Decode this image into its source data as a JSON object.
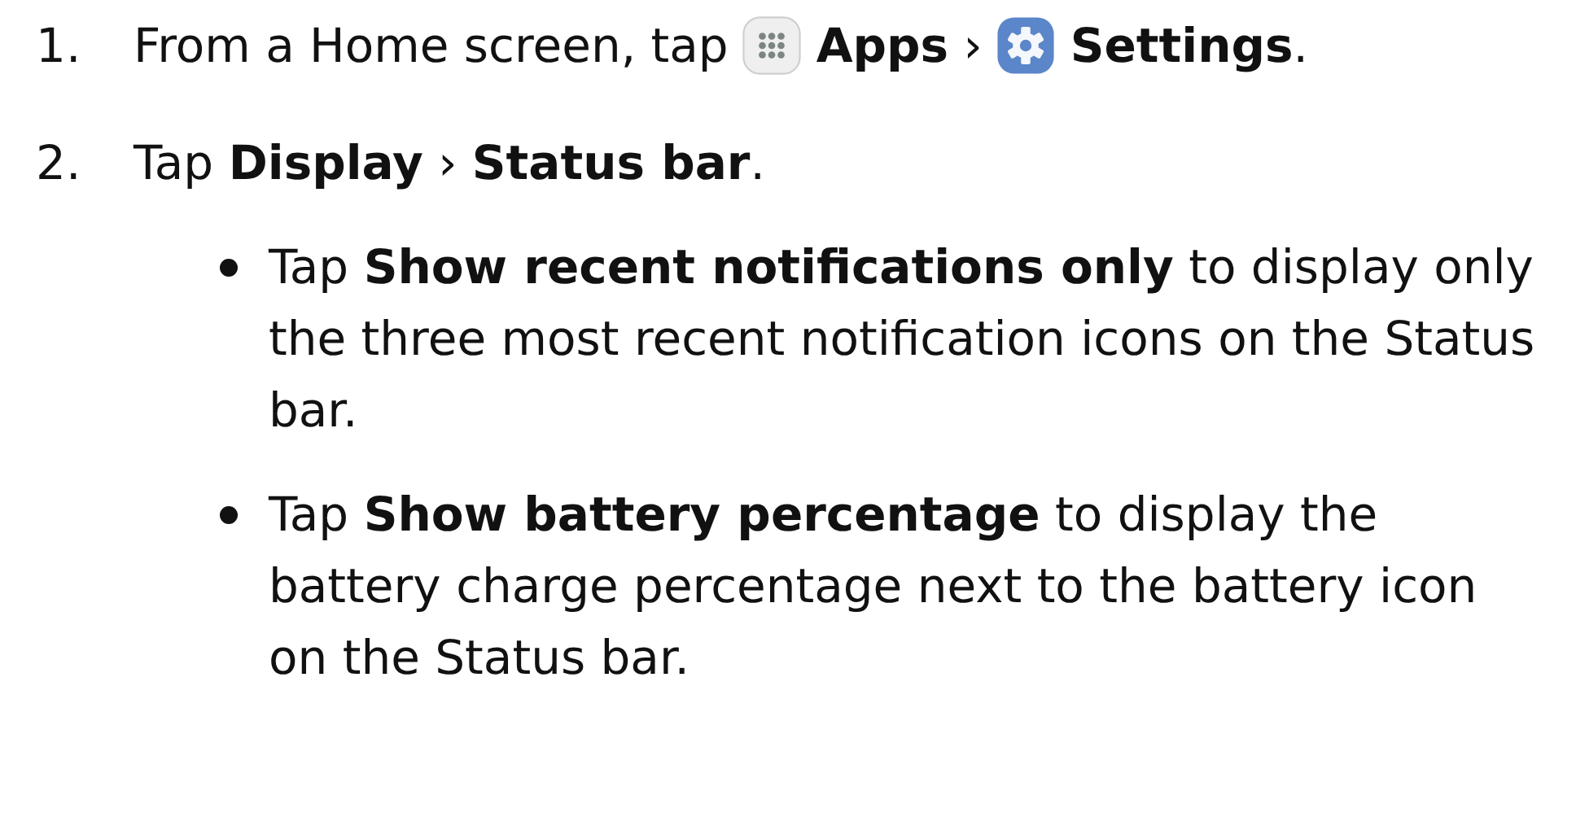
{
  "steps": [
    {
      "number": "1.",
      "parts": [
        {
          "kind": "text",
          "text": "From a Home screen, tap"
        },
        {
          "kind": "apps-icon"
        },
        {
          "kind": "text",
          "text": "**Apps** ›"
        },
        {
          "kind": "settings-icon"
        },
        {
          "kind": "text",
          "text": "**Settings**."
        }
      ]
    },
    {
      "number": "2.",
      "parts": [
        {
          "kind": "text",
          "text": "Tap **Display** › **Status bar**."
        }
      ],
      "bullets": [
        "Tap **Show recent notifications only** to display only the three most recent notification icons on the Status bar.",
        "Tap **Show battery percentage** to display the battery charge percentage next to the battery icon on the Status bar."
      ]
    }
  ]
}
